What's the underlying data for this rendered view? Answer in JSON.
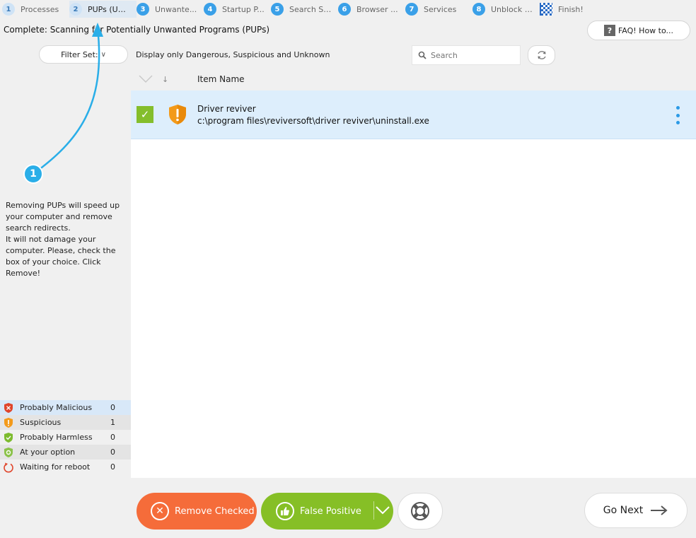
{
  "steps": [
    {
      "num": "1",
      "label": "Processes",
      "state": "done"
    },
    {
      "num": "2",
      "label": "PUPs (Un...",
      "state": "active"
    },
    {
      "num": "3",
      "label": "Unwante...",
      "state": "pending"
    },
    {
      "num": "4",
      "label": "Startup P...",
      "state": "pending"
    },
    {
      "num": "5",
      "label": "Search Se...",
      "state": "pending"
    },
    {
      "num": "6",
      "label": "Browser ...",
      "state": "pending"
    },
    {
      "num": "7",
      "label": "Services",
      "state": "pending"
    },
    {
      "num": "8",
      "label": "Unblock A...",
      "state": "pending"
    },
    {
      "num": "",
      "label": "Finish!",
      "state": "finish"
    }
  ],
  "status_title": "Complete: Scanning for Potentially Unwanted Programs (PUPs)",
  "faq": {
    "label": "FAQ! How to...",
    "icon": "question-icon"
  },
  "filter": {
    "label": "Filter Set:",
    "description": "Display only Dangerous, Suspicious and Unknown"
  },
  "search": {
    "placeholder": "Search"
  },
  "table": {
    "column_name": "Item Name"
  },
  "items": [
    {
      "name": "Driver reviver",
      "path": "c:\\program files\\reviversoft\\driver reviver\\uninstall.exe",
      "checked": true,
      "severity": "suspicious"
    }
  ],
  "tip": {
    "callout_number": "1",
    "line1": "Removing PUPs will speed up your computer and remove search redirects.",
    "line2": "It will not damage your computer. Please, check the box of your choice. Click Remove!"
  },
  "legend": [
    {
      "label": "Probably Malicious",
      "count": "0",
      "color": "#e0452b",
      "icon": "red-shield-icon"
    },
    {
      "label": "Suspicious",
      "count": "1",
      "color": "#f39a1a",
      "icon": "orange-shield-icon"
    },
    {
      "label": "Probably Harmless",
      "count": "0",
      "color": "#7dbb2e",
      "icon": "green-shield-icon"
    },
    {
      "label": "At your option",
      "count": "0",
      "color": "#8bc24a",
      "icon": "gear-shield-icon"
    },
    {
      "label": "Waiting for reboot",
      "count": "0",
      "color": "#e0452b",
      "icon": "reboot-icon"
    }
  ],
  "buttons": {
    "remove": "Remove Checked",
    "false_positive": "False Positive",
    "next": "Go Next"
  },
  "colors": {
    "accent": "#2b9ae6",
    "remove": "#f56c3a",
    "false_positive": "#86bf26"
  }
}
